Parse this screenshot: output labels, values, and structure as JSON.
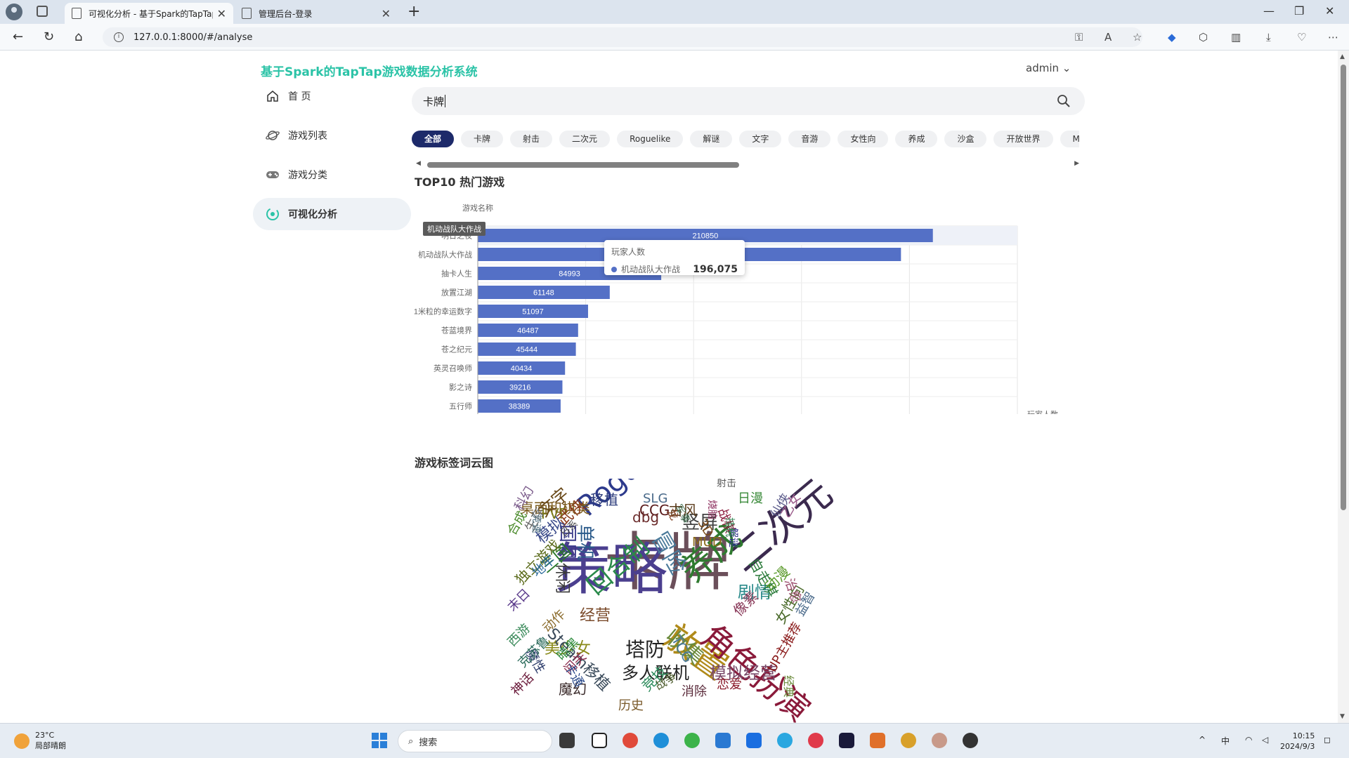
{
  "browser": {
    "tabs": [
      {
        "title": "可视化分析 - 基于Spark的TapTap游戏数据分析系统",
        "active": true
      },
      {
        "title": "管理后台-登录",
        "active": false
      }
    ],
    "url": "127.0.0.1:8000/#/analyse"
  },
  "header": {
    "brand": "基于Spark的TapTap游戏数据分析系统",
    "user": "admin"
  },
  "sidebar": {
    "items": [
      {
        "label": "首 页",
        "icon": "home-icon"
      },
      {
        "label": "游戏列表",
        "icon": "planet-icon"
      },
      {
        "label": "游戏分类",
        "icon": "gamepad-icon"
      },
      {
        "label": "可视化分析",
        "icon": "analysis-icon",
        "active": true
      }
    ]
  },
  "search": {
    "value": "卡牌"
  },
  "tags": [
    "全部",
    "卡牌",
    "射击",
    "二次元",
    "Roguelike",
    "解谜",
    "文字",
    "音游",
    "女性向",
    "养成",
    "沙盒",
    "开放世界",
    "MMORPG"
  ],
  "sections": {
    "top10_title": "TOP10 热门游戏",
    "cloud_title": "游戏标签词云图"
  },
  "chart_data": {
    "type": "bar",
    "orientation": "horizontal",
    "title": "TOP10 热门游戏",
    "ylabel": "游戏名称",
    "xlabel": "玩家人数",
    "xlim": [
      0,
      250000
    ],
    "xticks": [
      "0",
      "50,000",
      "100,000",
      "150,000",
      "200,000",
      "250,000"
    ],
    "categories": [
      "明日之夜",
      "机动战队大作战",
      "抽卡人生",
      "放置江湖",
      "1米粒的幸运数字",
      "苍蓝境界",
      "苍之纪元",
      "英灵召唤师",
      "影之诗",
      "五行师"
    ],
    "values": [
      210850,
      196075,
      84993,
      61148,
      51097,
      46487,
      45444,
      40434,
      39216,
      38389
    ],
    "labels": [
      "210850",
      "196075",
      "84993",
      "61148",
      "51097",
      "46487",
      "45444",
      "40434",
      "39216",
      "38389"
    ],
    "bar_color": "#5470c6",
    "grid": true
  },
  "tooltip": {
    "title": "玩家人数",
    "name": "机动战队大作战",
    "value": "196,075"
  },
  "hover_label": "机动战队大作战",
  "wordcloud": [
    {
      "t": "卡牌",
      "c": "#6b4f5a"
    },
    {
      "t": "策略",
      "c": "#4b3f8f"
    },
    {
      "t": "Roguelike",
      "c": "#2d3a8c"
    },
    {
      "t": "二次元",
      "c": "#3b2a4e"
    },
    {
      "t": "养成",
      "c": "#2f7a2f"
    },
    {
      "t": "放置",
      "c": "#b08a1a"
    },
    {
      "t": "角色扮演",
      "c": "#8a1a3a"
    },
    {
      "t": "回合制",
      "c": "#2a8a4a"
    },
    {
      "t": "塔防",
      "c": "#222222"
    },
    {
      "t": "收集",
      "c": "#6a8a3a"
    },
    {
      "t": "冒险",
      "c": "#4a7a9a"
    },
    {
      "t": "竖屏",
      "c": "#444444"
    },
    {
      "t": "美少女",
      "c": "#8a8a1a"
    },
    {
      "t": "多人联机",
      "c": "#222222"
    },
    {
      "t": "模拟经营",
      "c": "#7a4a6a"
    },
    {
      "t": "剧情",
      "c": "#2a8a8a"
    },
    {
      "t": "桌面和棋类",
      "c": "#7a5a1a"
    },
    {
      "t": "移植",
      "c": "#2a3a7a"
    },
    {
      "t": "CCG",
      "c": "#5a1a1a"
    },
    {
      "t": "古风",
      "c": "#5a3a1a"
    },
    {
      "t": "SLG",
      "c": "#4a6a8a"
    },
    {
      "t": "日漫",
      "c": "#3a8a3a"
    },
    {
      "t": "PVP",
      "c": "#7a7a1a"
    },
    {
      "t": "MUD",
      "c": "#8a6a1a"
    },
    {
      "t": "单机",
      "c": "#2a5a8a"
    },
    {
      "t": "国风",
      "c": "#3a3a8a"
    },
    {
      "t": "dbg",
      "c": "#6a2a2a"
    },
    {
      "t": "文字",
      "c": "#6a4a1a"
    },
    {
      "t": "武侠",
      "c": "#8a3a1a"
    },
    {
      "t": "模拟",
      "c": "#3a4a8a"
    },
    {
      "t": "休闲",
      "c": "#3a3a3a"
    },
    {
      "t": "三国",
      "c": "#2a7a2a"
    },
    {
      "t": "独立游戏",
      "c": "#5a6a1a"
    },
    {
      "t": "经营",
      "c": "#7a4a2a"
    },
    {
      "t": "Steam移植",
      "c": "#3a4a5a"
    },
    {
      "t": "魔幻",
      "c": "#3a2a2a"
    },
    {
      "t": "历史",
      "c": "#7a5a2a"
    },
    {
      "t": "消除",
      "c": "#5a2a3a"
    },
    {
      "t": "恋爱",
      "c": "#8a1a2a"
    },
    {
      "t": "竞技",
      "c": "#2a8a5a"
    },
    {
      "t": "TCG",
      "c": "#4a7a9a"
    },
    {
      "t": "像素",
      "c": "#8a3a5a"
    },
    {
      "t": "自走棋",
      "c": "#2a7a3a"
    },
    {
      "t": "动漫",
      "c": "#5a9a2a"
    },
    {
      "t": "女性向",
      "c": "#4a6a2a"
    },
    {
      "t": "治愈",
      "c": "#9a4a6a"
    },
    {
      "t": "益智",
      "c": "#4a6a8a"
    },
    {
      "t": "UP主推荐",
      "c": "#8a1a1a"
    },
    {
      "t": "科幻",
      "c": "#7a5a8a"
    },
    {
      "t": "合成",
      "c": "#4a8a2a"
    },
    {
      "t": "生存",
      "c": "#6a6a6a"
    },
    {
      "t": "地牢",
      "c": "#2a6a9a"
    },
    {
      "t": "末日",
      "c": "#5a3a8a"
    },
    {
      "t": "西游",
      "c": "#3a8a5a"
    },
    {
      "t": "动作",
      "c": "#8a6a2a"
    },
    {
      "t": "魔性",
      "c": "#2a3a6a"
    },
    {
      "t": "克苏鲁",
      "c": "#2a6a5a"
    },
    {
      "t": "神话",
      "c": "#6a1a3a"
    },
    {
      "t": "暗黑",
      "c": "#2a8a3a"
    },
    {
      "t": "闯关",
      "c": "#8a2a4a"
    },
    {
      "t": "卡通",
      "c": "#2a4a8a"
    },
    {
      "t": "战争",
      "c": "#4a5a2a"
    },
    {
      "t": "AVG",
      "c": "#3a3a6a"
    },
    {
      "t": "竞速",
      "c": "#5a7a8a"
    },
    {
      "t": "日系",
      "c": "#4a4a4a"
    },
    {
      "t": "龙",
      "c": "#7a3a1a"
    },
    {
      "t": "3D",
      "c": "#7a4a1a"
    },
    {
      "t": "战棋",
      "c": "#8a1a3a"
    },
    {
      "t": "仙侠",
      "c": "#5a5a8a"
    },
    {
      "t": "乙女",
      "c": "#9a5a8a"
    },
    {
      "t": "烧脑",
      "c": "#8a2a5a"
    },
    {
      "t": "经典",
      "c": "#6a8a3a"
    },
    {
      "t": "军事",
      "c": "#3a6a4a"
    },
    {
      "t": "解谜",
      "c": "#2a2a8a"
    },
    {
      "t": "挂机",
      "c": "#3a8a5a"
    },
    {
      "t": "射击",
      "c": "#5a5a5a"
    }
  ],
  "taskbar": {
    "temp": "23°C",
    "weather": "局部晴朗",
    "search": "搜索",
    "ime": "中",
    "time": "10:15",
    "date": "2024/9/3"
  }
}
